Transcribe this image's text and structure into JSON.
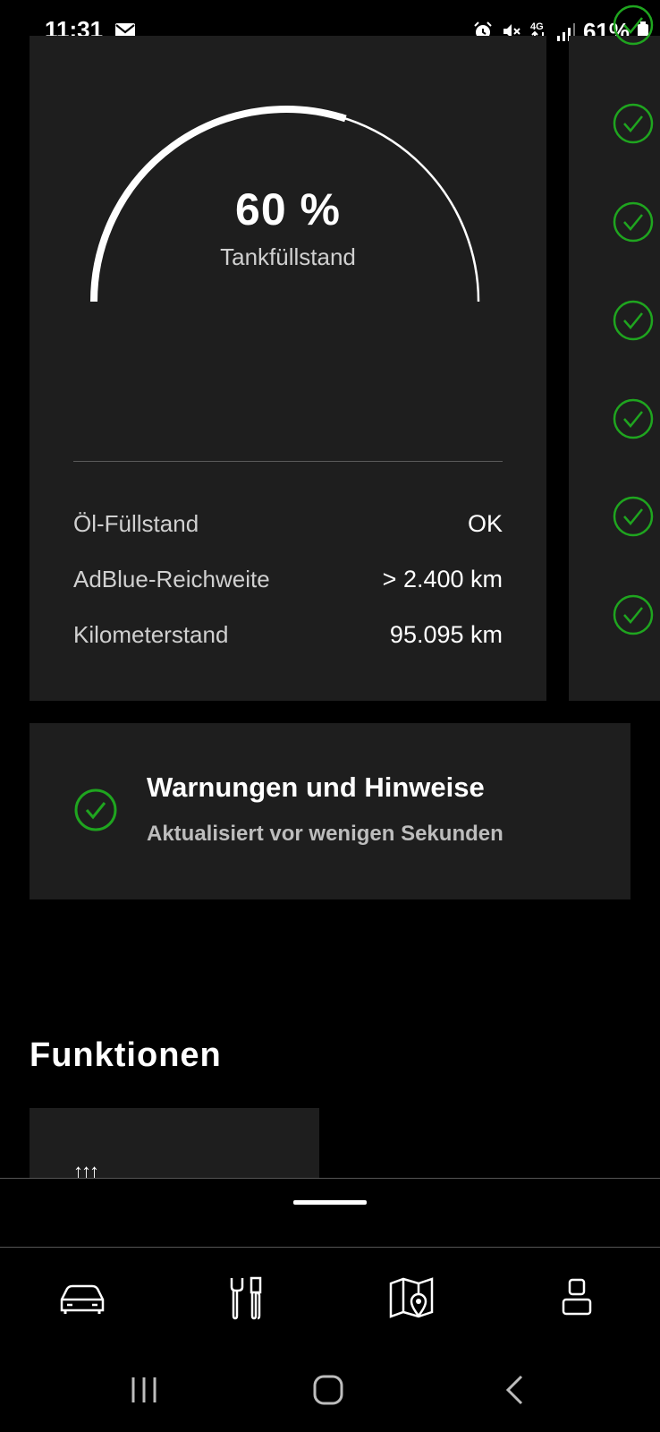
{
  "status_bar": {
    "time": "11:31",
    "battery_percent": "61%",
    "icons": [
      "mail-icon",
      "alarm-icon",
      "mute-icon",
      "network-4g-icon",
      "signal-icon",
      "battery-icon"
    ]
  },
  "tank_card": {
    "fill_percent_text": "60 %",
    "fill_fraction": 0.6,
    "label": "Tankfüllstand",
    "rows": [
      {
        "label": "Öl-Füllstand",
        "value": "OK"
      },
      {
        "label": "AdBlue-Reichweite",
        "value": "> 2.400 km"
      },
      {
        "label": "Kilometerstand",
        "value": "95.095 km"
      }
    ]
  },
  "side_card": {
    "status_icons": [
      "check-circle-icon",
      "check-circle-icon",
      "check-circle-icon",
      "check-circle-icon",
      "check-circle-icon",
      "check-circle-icon",
      "check-circle-icon"
    ]
  },
  "warnings": {
    "title": "Warnungen und Hinweise",
    "subtitle": "Aktualisiert vor wenigen Sekunden"
  },
  "functions": {
    "title": "Funktionen",
    "first_card_icon": "↑↑↑"
  },
  "bottom_nav": {
    "items": [
      "car-icon",
      "tools-icon",
      "map-icon",
      "profile-icon"
    ]
  },
  "system_nav": {
    "items": [
      "recents-icon",
      "home-icon",
      "back-icon"
    ]
  },
  "colors": {
    "background": "#000000",
    "card": "#1e1e1e",
    "success_green": "#1fa51f",
    "text_secondary": "#d0d0d0"
  }
}
